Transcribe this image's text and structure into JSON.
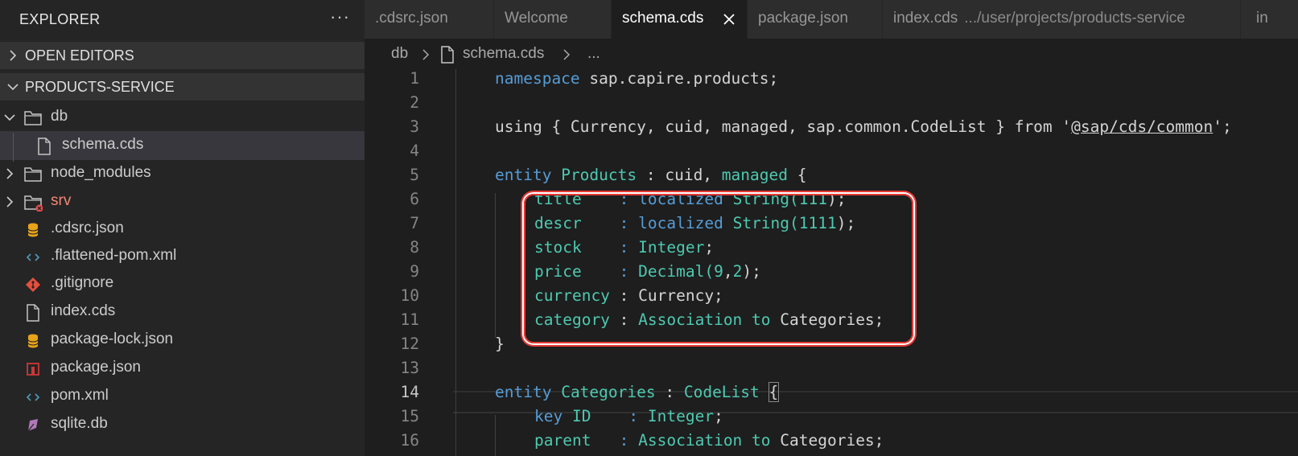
{
  "explorer": {
    "title": "EXPLORER",
    "more_label": "···",
    "sections": {
      "open_editors": "OPEN EDITORS",
      "project": "PRODUCTS-SERVICE"
    },
    "tree": [
      {
        "label": "db",
        "kind": "folder",
        "expanded": true
      },
      {
        "label": "schema.cds",
        "kind": "file"
      },
      {
        "label": "node_modules",
        "kind": "folder",
        "expanded": false
      },
      {
        "label": "srv",
        "kind": "folder",
        "expanded": false,
        "error": true
      },
      {
        "label": ".cdsrc.json",
        "kind": "json"
      },
      {
        "label": ".flattened-pom.xml",
        "kind": "xml"
      },
      {
        "label": ".gitignore",
        "kind": "git"
      },
      {
        "label": "index.cds",
        "kind": "file"
      },
      {
        "label": "package-lock.json",
        "kind": "json"
      },
      {
        "label": "package.json",
        "kind": "npm"
      },
      {
        "label": "pom.xml",
        "kind": "xml"
      },
      {
        "label": "sqlite.db",
        "kind": "db"
      }
    ]
  },
  "tabs": [
    {
      "label": ".cdsrc.json"
    },
    {
      "label": "Welcome"
    },
    {
      "label": "schema.cds",
      "active": true
    },
    {
      "label": "package.json"
    },
    {
      "label": "index.cds",
      "description": ".../user/projects/products-service"
    },
    {
      "label": "in"
    }
  ],
  "breadcrumb": {
    "folder": "db",
    "file": "schema.cds",
    "more": "..."
  },
  "editor": {
    "current_line": 14,
    "lines": [
      {
        "n": "1"
      },
      {
        "n": "2"
      },
      {
        "n": "3"
      },
      {
        "n": "4"
      },
      {
        "n": "5"
      },
      {
        "n": "6"
      },
      {
        "n": "7"
      },
      {
        "n": "8"
      },
      {
        "n": "9"
      },
      {
        "n": "10"
      },
      {
        "n": "11"
      },
      {
        "n": "12"
      },
      {
        "n": "13"
      },
      {
        "n": "14"
      },
      {
        "n": "15"
      },
      {
        "n": "16"
      }
    ],
    "tokens": {
      "l1": [
        "namespace",
        " sap.capire.products;"
      ],
      "l3": [
        "using { Currency, cuid, managed, sap.common.CodeList } from '",
        "@sap/cds/common",
        "';"
      ],
      "l5": [
        "entity",
        " ",
        "Products",
        " : cuid, ",
        "managed",
        " {"
      ],
      "l6": [
        "title",
        "    : ",
        "localized",
        " ",
        "String(",
        "111",
        ");"
      ],
      "l7": [
        "descr",
        "    : ",
        "localized",
        " ",
        "String(",
        "1111",
        ");"
      ],
      "l8": [
        "stock",
        "    : ",
        "Integer",
        ";"
      ],
      "l9": [
        "price",
        "    : ",
        "Decimal(",
        "9",
        ",",
        "2",
        ");"
      ],
      "l10": [
        "currency",
        " : Currency;"
      ],
      "l11": [
        "category",
        " : ",
        "Association",
        " ",
        "to",
        " Categories;"
      ],
      "l12": [
        "}"
      ],
      "l14": [
        "entity",
        " ",
        "Categories",
        " : ",
        "CodeList",
        " ",
        "{"
      ],
      "l15": [
        "key",
        " ",
        "ID",
        "    : ",
        "Integer",
        ";"
      ],
      "l16": [
        "parent",
        "   : ",
        "Association",
        " ",
        "to",
        " Categories;"
      ]
    }
  },
  "colors": {
    "keyword": "#569cd6",
    "type": "#4ec9b0",
    "highlight_border": "#e53935"
  }
}
